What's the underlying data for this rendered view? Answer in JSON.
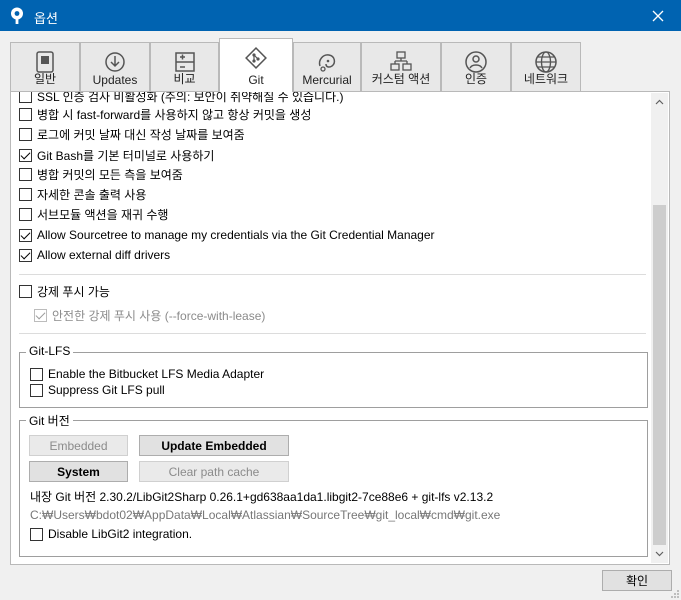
{
  "window": {
    "title": "옵션",
    "close_icon": "close-icon",
    "app_icon": "sourcetree-icon"
  },
  "tabs": [
    {
      "label": "일반",
      "icon": "general-icon"
    },
    {
      "label": "Updates",
      "icon": "download-icon"
    },
    {
      "label": "비교",
      "icon": "diff-icon"
    },
    {
      "label": "Git",
      "icon": "git-icon",
      "active": true
    },
    {
      "label": "Mercurial",
      "icon": "mercurial-icon"
    },
    {
      "label": "커스텀 액션",
      "icon": "custom-action-icon"
    },
    {
      "label": "인증",
      "icon": "user-icon"
    },
    {
      "label": "네트워크",
      "icon": "globe-icon"
    }
  ],
  "options": [
    {
      "label": "SSL 인증 검사 비활성화 (주의: 보안이 취약해질 수 있습니다.)",
      "checked": false
    },
    {
      "label": "병합 시 fast-forward를 사용하지 않고 항상 커밋을 생성",
      "checked": false
    },
    {
      "label": "로그에 커밋 날짜 대신 작성 날짜를 보여줌",
      "checked": false
    },
    {
      "label": "Git Bash를 기본 터미널로 사용하기",
      "checked": true
    },
    {
      "label": "병합 커밋의 모든 측을 보여줌",
      "checked": false
    },
    {
      "label": "자세한 콘솔 출력 사용",
      "checked": false
    },
    {
      "label": "서브모듈 액션을 재귀 수행",
      "checked": false
    },
    {
      "label": "Allow Sourcetree to manage my credentials via the Git Credential Manager",
      "checked": true
    },
    {
      "label": "Allow external diff drivers",
      "checked": true
    }
  ],
  "force_push": {
    "label": "강제 푸시 가능",
    "checked": false,
    "safe_label": "안전한 강제 푸시 사용 (--force-with-lease)",
    "safe_checked": true,
    "safe_disabled": true
  },
  "git_lfs": {
    "legend": "Git-LFS",
    "options": [
      {
        "label": "Enable the Bitbucket LFS Media Adapter",
        "checked": false
      },
      {
        "label": "Suppress Git LFS pull",
        "checked": false
      }
    ]
  },
  "git_version": {
    "legend": "Git 버전",
    "embedded_label": "Embedded",
    "update_embedded_label": "Update Embedded",
    "system_label": "System",
    "clear_cache_label": "Clear path cache",
    "version_text": "내장 Git 버전 2.30.2/LibGit2Sharp 0.26.1+gd638aa1da1.libgit2-7ce88e6 + git-lfs v2.13.2",
    "path_text": "C:₩Users₩bdot02₩AppData₩Local₩Atlassian₩SourceTree₩git_local₩cmd₩git.exe",
    "disable_libgit2_label": "Disable LibGit2 integration.",
    "disable_libgit2_checked": false
  },
  "footer": {
    "ok_label": "확인"
  }
}
